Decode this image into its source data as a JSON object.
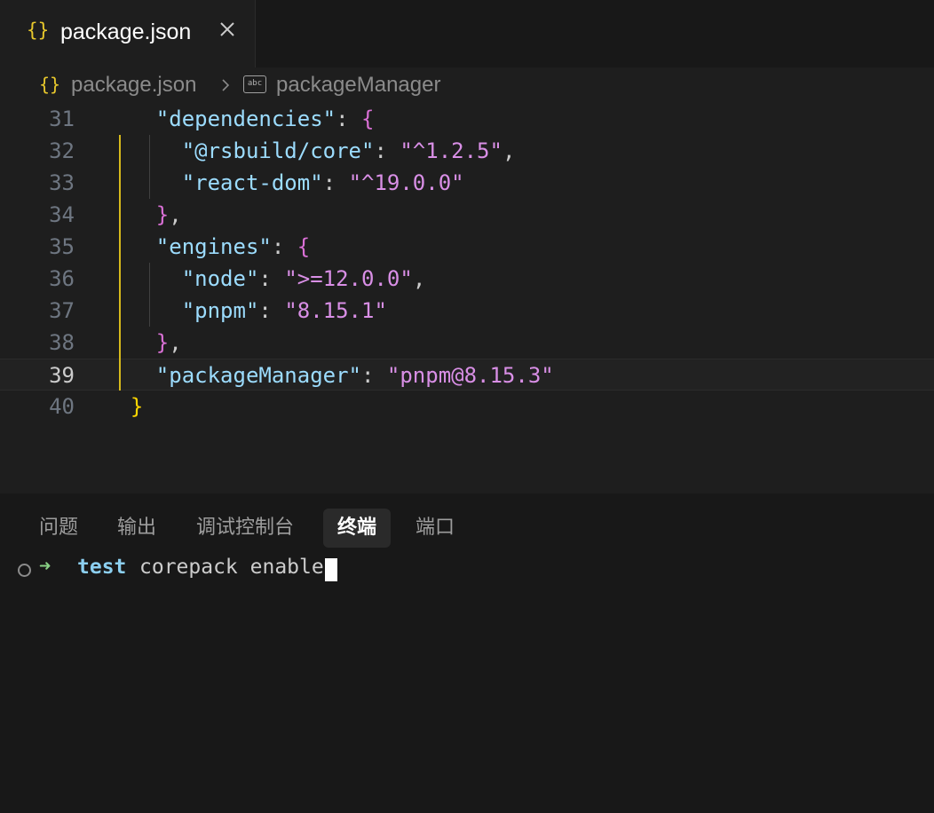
{
  "tab": {
    "icon": "{}",
    "label": "package.json"
  },
  "breadcrumb": {
    "file_icon": "{}",
    "file": "package.json",
    "symbol_icon": "abc",
    "symbol": "packageManager"
  },
  "editor": {
    "current_line": "39",
    "lines": [
      {
        "n": "31",
        "parts": [
          [
            "    ",
            "p"
          ],
          [
            "\"dependencies\"",
            "jkey"
          ],
          [
            ": ",
            "p"
          ],
          [
            "{",
            "b2"
          ]
        ]
      },
      {
        "n": "32",
        "parts": [
          [
            "      ",
            "p"
          ],
          [
            "\"@rsbuild/core\"",
            "jkey"
          ],
          [
            ": ",
            "p"
          ],
          [
            "\"^1.2.5\"",
            "jstr"
          ],
          [
            ",",
            "p"
          ]
        ]
      },
      {
        "n": "33",
        "parts": [
          [
            "      ",
            "p"
          ],
          [
            "\"react-dom\"",
            "jkey"
          ],
          [
            ": ",
            "p"
          ],
          [
            "\"^19.0.0\"",
            "jstr"
          ]
        ]
      },
      {
        "n": "34",
        "parts": [
          [
            "    ",
            "p"
          ],
          [
            "}",
            "b2"
          ],
          [
            ",",
            "p"
          ]
        ]
      },
      {
        "n": "35",
        "parts": [
          [
            "    ",
            "p"
          ],
          [
            "\"engines\"",
            "jkey"
          ],
          [
            ": ",
            "p"
          ],
          [
            "{",
            "b2"
          ]
        ]
      },
      {
        "n": "36",
        "parts": [
          [
            "      ",
            "p"
          ],
          [
            "\"node\"",
            "jkey"
          ],
          [
            ": ",
            "p"
          ],
          [
            "\">=12.0.0\"",
            "jstr"
          ],
          [
            ",",
            "p"
          ]
        ]
      },
      {
        "n": "37",
        "parts": [
          [
            "      ",
            "p"
          ],
          [
            "\"pnpm\"",
            "jkey"
          ],
          [
            ": ",
            "p"
          ],
          [
            "\"8.15.1\"",
            "jstr"
          ]
        ]
      },
      {
        "n": "38",
        "parts": [
          [
            "    ",
            "p"
          ],
          [
            "}",
            "b2"
          ],
          [
            ",",
            "p"
          ]
        ]
      },
      {
        "n": "39",
        "parts": [
          [
            "    ",
            "p"
          ],
          [
            "\"packageManager\"",
            "jkey"
          ],
          [
            ": ",
            "p"
          ],
          [
            "\"pnpm@8.15.3\"",
            "jstr"
          ]
        ]
      },
      {
        "n": "40",
        "parts": [
          [
            "  ",
            "p"
          ],
          [
            "}",
            "b1"
          ]
        ]
      }
    ]
  },
  "panel": {
    "tabs": [
      "问题",
      "输出",
      "调试控制台",
      "终端",
      "端口"
    ],
    "active_tab": "终端"
  },
  "terminal": {
    "arrow": "➜",
    "dir": "test",
    "command": "corepack enable"
  },
  "colors": {
    "accent_yellow": "#d7ba1c",
    "json_key": "#9cdcfe",
    "json_string": "#d98fe6",
    "prompt_arrow": "#89d185"
  }
}
